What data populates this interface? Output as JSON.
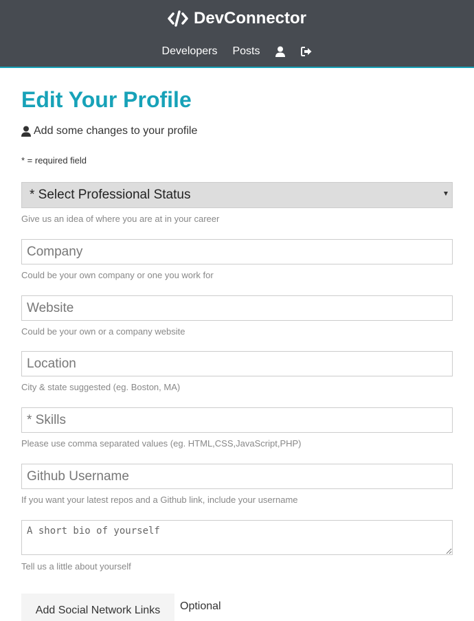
{
  "navbar": {
    "brand": "DevConnector",
    "brand_icon": "code-icon",
    "links": [
      "Developers",
      "Posts"
    ],
    "icons": [
      "user-icon",
      "sign-out-icon"
    ]
  },
  "page": {
    "title": "Edit Your Profile",
    "lead": "Add some changes to your profile",
    "lead_icon": "user-icon",
    "required_note": "* = required field"
  },
  "form": {
    "status": {
      "selected": "* Select Professional Status",
      "hint": "Give us an idea of where you are at in your career"
    },
    "company": {
      "placeholder": "Company",
      "hint": "Could be your own company or one you work for"
    },
    "website": {
      "placeholder": "Website",
      "hint": "Could be your own or a company website"
    },
    "location": {
      "placeholder": "Location",
      "hint": "City & state suggested (eg. Boston, MA)"
    },
    "skills": {
      "placeholder": "* Skills",
      "hint": "Please use comma separated values (eg. HTML,CSS,JavaScript,PHP)"
    },
    "github": {
      "placeholder": "Github Username",
      "hint": "If you want your latest repos and a Github link, include your username"
    },
    "bio": {
      "placeholder": "A short bio of yourself",
      "hint": "Tell us a little about yourself"
    },
    "social_button": "Add Social Network Links",
    "optional_label": "Optional"
  },
  "colors": {
    "navbar_bg": "#474b51",
    "primary": "#17a2b8"
  }
}
